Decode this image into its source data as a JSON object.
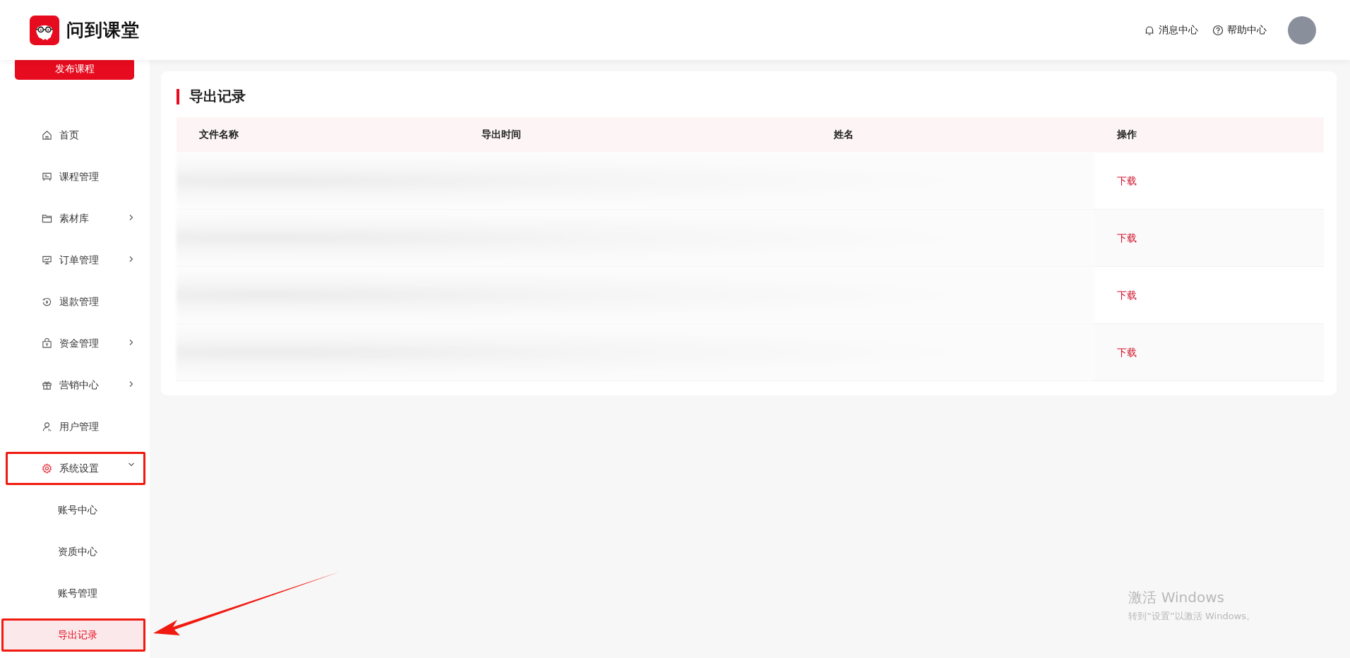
{
  "header": {
    "brand": "问到课堂",
    "links": [
      {
        "label": "消息中心"
      },
      {
        "label": "帮助中心"
      }
    ]
  },
  "sidebar": {
    "publish_button": "发布课程",
    "items": [
      {
        "label": "首页",
        "selected": false,
        "highlighted": false
      },
      {
        "label": "课程管理",
        "selected": false,
        "highlighted": false
      },
      {
        "label": "素材库",
        "selected": false,
        "highlighted": false,
        "expanded": false
      },
      {
        "label": "订单管理",
        "selected": false,
        "highlighted": false,
        "expanded": false
      },
      {
        "label": "退款管理",
        "selected": false,
        "highlighted": false
      },
      {
        "label": "资金管理",
        "selected": false,
        "highlighted": false,
        "expanded": false
      },
      {
        "label": "营销中心",
        "selected": false,
        "highlighted": false,
        "expanded": false
      },
      {
        "label": "用户管理",
        "selected": false,
        "highlighted": false
      },
      {
        "label": "系统设置",
        "selected": false,
        "highlighted": true,
        "expanded": true,
        "children": [
          {
            "label": "账号中心",
            "selected": false,
            "highlighted": false
          },
          {
            "label": "资质中心",
            "selected": false,
            "highlighted": false
          },
          {
            "label": "账号管理",
            "selected": false,
            "highlighted": false
          },
          {
            "label": "导出记录",
            "selected": true,
            "highlighted": true
          }
        ]
      }
    ]
  },
  "panel": {
    "title": "导出记录",
    "table": {
      "columns": [
        "文件名称",
        "导出时间",
        "姓名",
        "操作"
      ],
      "rows": [
        {
          "action": "下载"
        },
        {
          "action": "下载"
        },
        {
          "action": "下载"
        },
        {
          "action": "下载"
        }
      ]
    }
  },
  "os_notice": {
    "title": "激活 Windows",
    "text": "转到“设置”以激活 Windows。"
  }
}
